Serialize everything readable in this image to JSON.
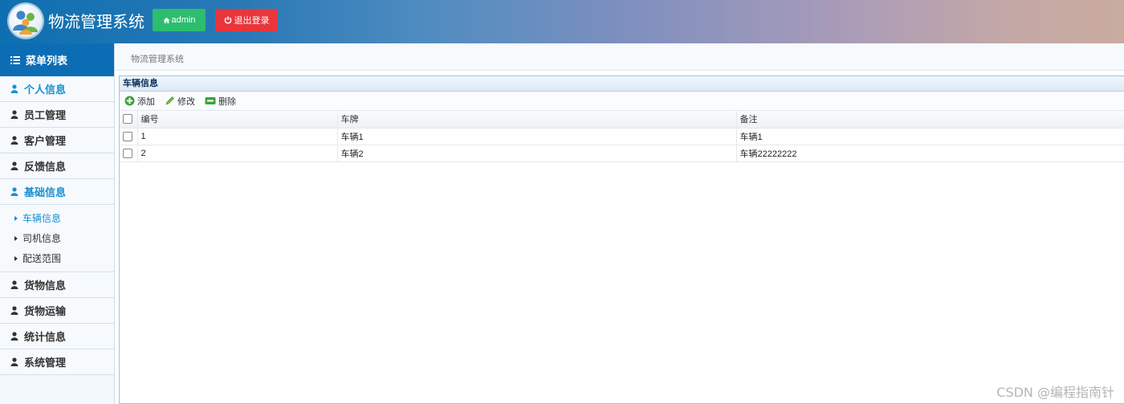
{
  "header": {
    "app_title": "物流管理系统",
    "admin_label": "admin",
    "logout_label": "退出登录"
  },
  "sidebar": {
    "menu_title": "菜单列表",
    "items": [
      {
        "label": "个人信息"
      },
      {
        "label": "员工管理"
      },
      {
        "label": "客户管理"
      },
      {
        "label": "反馈信息"
      },
      {
        "label": "基础信息"
      },
      {
        "label": "货物信息"
      },
      {
        "label": "货物运输"
      },
      {
        "label": "统计信息"
      },
      {
        "label": "系统管理"
      }
    ],
    "subitems": [
      {
        "label": "车辆信息"
      },
      {
        "label": "司机信息"
      },
      {
        "label": "配送范围"
      }
    ]
  },
  "breadcrumb": "物流管理系统",
  "panel": {
    "title": "车辆信息",
    "toolbar": {
      "add": "添加",
      "edit": "修改",
      "delete": "删除"
    },
    "table": {
      "headers": [
        "编号",
        "车牌",
        "备注"
      ],
      "rows": [
        [
          "1",
          "车辆1",
          "车辆1"
        ],
        [
          "2",
          "车辆2",
          "车辆22222222"
        ]
      ]
    }
  },
  "watermark": "CSDN @编程指南针",
  "colors": {
    "primary": "#0d6db4",
    "active_text": "#1b8fd0",
    "admin_button": "#2dbd6e",
    "logout_button": "#e8363c"
  }
}
